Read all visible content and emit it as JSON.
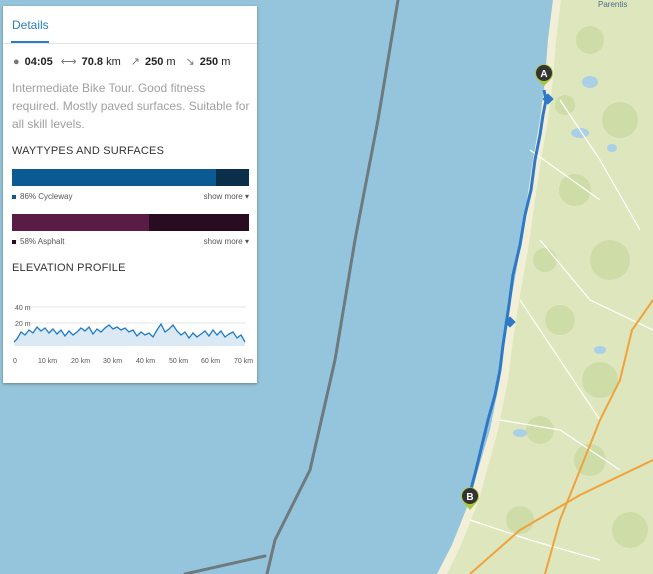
{
  "map": {
    "town_label": "Parentis",
    "marker_start": "A",
    "marker_end": "B",
    "colors": {
      "sea": "#95c5dc",
      "land": "#dde6bd",
      "route": "#2f78c8"
    }
  },
  "panel": {
    "tab_label": "Details",
    "stats": {
      "duration": "04:05",
      "distance": "70.8",
      "distance_unit": "km",
      "ascent": "250",
      "ascent_unit": "m",
      "descent": "250",
      "descent_unit": "m"
    },
    "description": "Intermediate Bike Tour. Good fitness required. Mostly paved surfaces. Suitable for all skill levels.",
    "waytypes_heading": "WAYTYPES AND SURFACES",
    "waytype": {
      "legend": "86% Cycleway",
      "percent": 86,
      "show_more": "show more"
    },
    "surface": {
      "legend": "58% Asphalt",
      "percent": 58,
      "show_more": "show more"
    },
    "elevation_heading": "ELEVATION PROFILE",
    "elevation": {
      "y_ticks": [
        "40 m",
        "20 m"
      ],
      "x_ticks": [
        "0",
        "10 km",
        "20 km",
        "30 km",
        "40 km",
        "50 km",
        "60 km",
        "70 km"
      ]
    }
  }
}
